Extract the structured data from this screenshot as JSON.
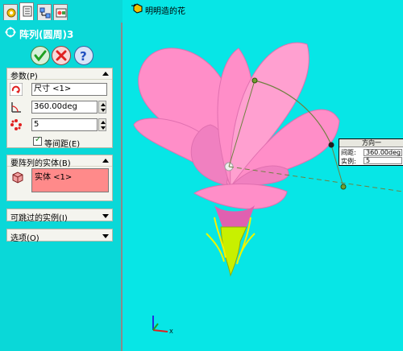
{
  "tabs": [
    {
      "name": "feature-manager",
      "icon": "feature-tree-icon"
    },
    {
      "name": "property-manager",
      "icon": "property-manager-icon"
    },
    {
      "name": "configuration-manager",
      "icon": "configuration-manager-icon"
    },
    {
      "name": "display-manager",
      "icon": "display-manager-icon"
    }
  ],
  "feature_title": "阵列(圆周)3",
  "buttons": {
    "ok_icon": "check-icon",
    "cancel_icon": "x-icon",
    "help_icon": "question-icon"
  },
  "params": {
    "header": "参数(P)",
    "axis_value": "尺寸 <1>",
    "angle_value": "360.00deg",
    "count_value": "5",
    "equal_spacing_label": "等间距(E)"
  },
  "bodies": {
    "header": "要阵列的实体(B)",
    "item": "实体 <1>"
  },
  "skip_header": "可跳过的实例(I)",
  "options_header": "选项(O)",
  "viewport": {
    "tree_label": "明明造的花"
  },
  "callout": {
    "title": "方向一",
    "spacing_label": "间距:",
    "spacing_value": "360.00deg",
    "instances_label": "实例:",
    "instances_value": "5"
  },
  "colors": {
    "background": "#07e6e6",
    "petal": "#ff8ec8",
    "petal_light": "#ffb8dc",
    "stem": "#c8f000",
    "selection": "#ff8a8a"
  }
}
